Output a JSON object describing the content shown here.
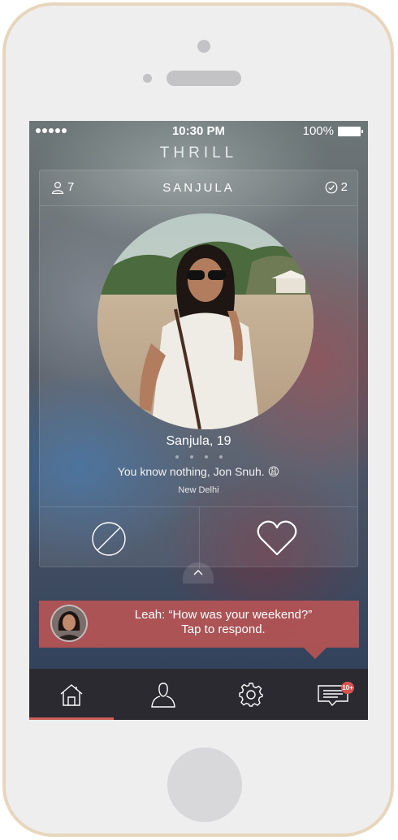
{
  "status_bar": {
    "time": "10:30 PM",
    "battery": "100%"
  },
  "app": {
    "title": "THRILL"
  },
  "card": {
    "followers_count": "7",
    "name": "SANJULA",
    "matches_count": "2",
    "profile_name_age": "Sanjula, 19",
    "bio": "You know nothing, Jon Snuh. 😩",
    "location": "New Delhi",
    "photo_dots": 4
  },
  "notification": {
    "line1": "Leah: “How was your weekend?”",
    "line2": "Tap to respond."
  },
  "tabbar": {
    "messages_badge": "10+"
  },
  "colors": {
    "accent": "#d0605a",
    "notification_bg": "#b85454",
    "tabbar_bg": "#2b2a31",
    "phone_frame": "#e8d6bc"
  }
}
